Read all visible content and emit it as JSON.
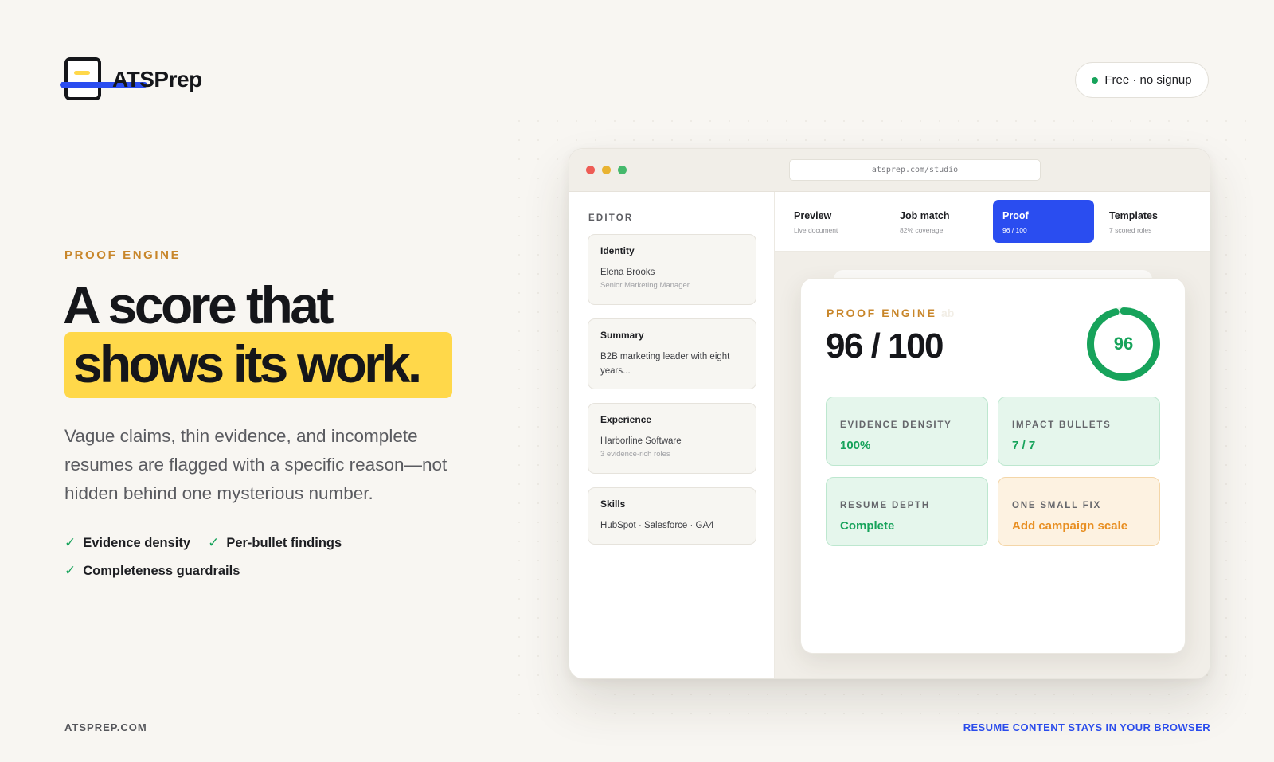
{
  "brand": {
    "name": "ATSPrep"
  },
  "badge": {
    "label": "Free · no signup",
    "dot_color": "#17a35b"
  },
  "hero": {
    "eyebrow": "PROOF ENGINE",
    "headline_line1": "A score that",
    "headline_line2": "shows its work.",
    "lead": "Vague claims, thin evidence, and incomplete resumes are flagged with a specific reason—not hidden behind one mysterious number.",
    "checks": [
      {
        "label": "Evidence density"
      },
      {
        "label": "Per-bullet findings"
      },
      {
        "label": "Completeness guardrails"
      }
    ]
  },
  "footer": {
    "left": "ATSPREP.COM",
    "right": "RESUME CONTENT STAYS IN YOUR BROWSER"
  },
  "browser": {
    "url": "atsprep.com/studio",
    "sidebar": {
      "title": "EDITOR",
      "cards": [
        {
          "heading": "Identity",
          "text": "Elena Brooks",
          "sub": "Senior Marketing Manager"
        },
        {
          "heading": "Summary",
          "text": "B2B marketing leader with eight years..."
        },
        {
          "heading": "Experience",
          "text": "Harborline Software",
          "sub": "3 evidence-rich roles"
        },
        {
          "heading": "Skills",
          "text": "HubSpot · Salesforce · GA4"
        }
      ]
    },
    "tabs": [
      {
        "label": "Preview",
        "sub": "Live document",
        "active": false
      },
      {
        "label": "Job match",
        "sub": "82% coverage",
        "active": false
      },
      {
        "label": "Proof",
        "sub": "96 / 100",
        "active": true
      },
      {
        "label": "Templates",
        "sub": "7 scored roles",
        "active": false
      }
    ],
    "proof": {
      "eyebrow": "PROOF ENGINE",
      "ghost_text": "ab",
      "score_text": "96 / 100",
      "score": 96,
      "score_max": 100,
      "ring_label": "96",
      "ring_color": "#17a35b",
      "metrics": [
        {
          "label": "EVIDENCE DENSITY",
          "value": "100%",
          "tone": "green"
        },
        {
          "label": "IMPACT BULLETS",
          "value": "7 / 7",
          "tone": "green"
        },
        {
          "label": "RESUME DEPTH",
          "value": "Complete",
          "tone": "green"
        },
        {
          "label": "ONE SMALL FIX",
          "value": "Add campaign scale",
          "tone": "orange"
        }
      ]
    }
  },
  "colors": {
    "accent_blue": "#2a4df0",
    "highlight_yellow": "#ffd84a",
    "eyebrow_orange": "#c8862a",
    "success_green": "#17a35b",
    "warning_orange": "#e88f22"
  }
}
